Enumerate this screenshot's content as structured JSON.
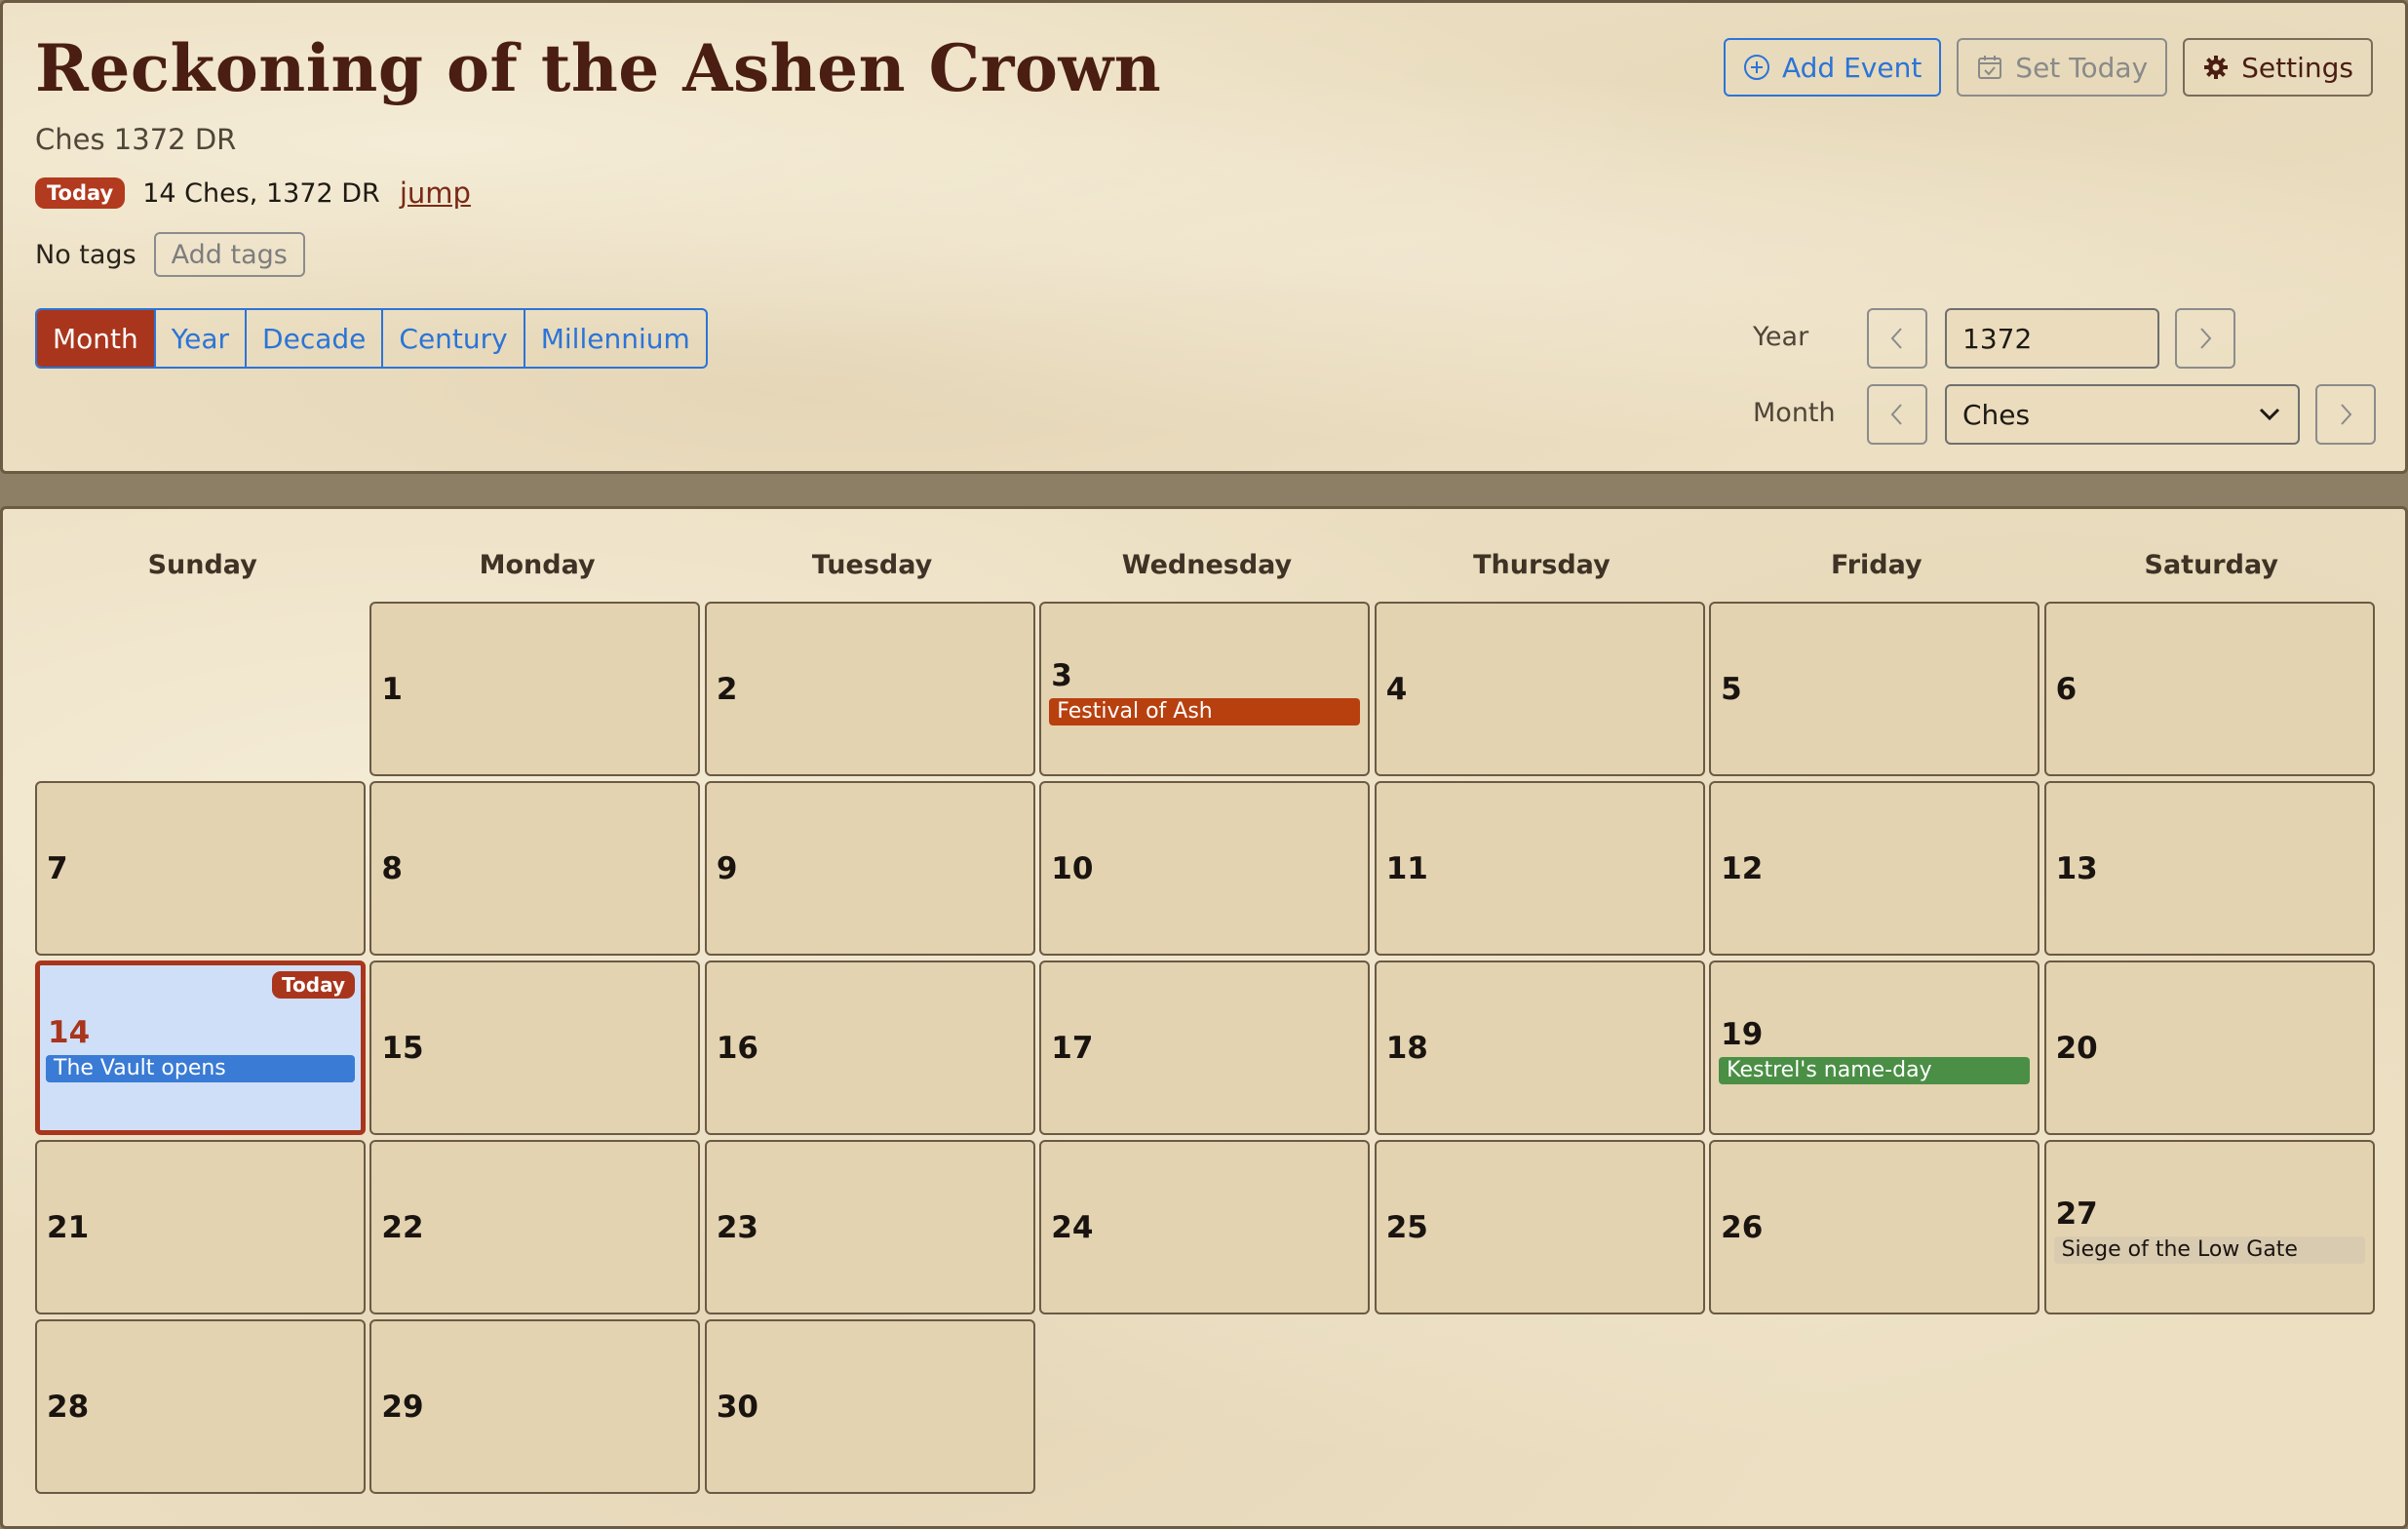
{
  "header": {
    "title": "Reckoning of the Ashen Crown",
    "subtitle": "Ches 1372 DR",
    "today_pill": "Today",
    "today_date": "14 Ches, 1372 DR",
    "jump_label": "jump",
    "tags_label": "No tags",
    "add_tags_label": "Add tags",
    "view_tabs": [
      "Month",
      "Year",
      "Decade",
      "Century",
      "Millennium"
    ],
    "active_view": "Month",
    "buttons": {
      "add_event": "Add Event",
      "set_today": "Set Today",
      "settings": "Settings"
    },
    "nav": {
      "year_label": "Year",
      "year_value": "1372",
      "month_label": "Month",
      "month_value": "Ches"
    }
  },
  "calendar": {
    "day_names": [
      "Sunday",
      "Monday",
      "Tuesday",
      "Wednesday",
      "Thursday",
      "Friday",
      "Saturday"
    ],
    "first_weekday": 1,
    "days_in_month": 30,
    "today": 14,
    "today_badge": "Today",
    "events": [
      {
        "day": 3,
        "label": "Festival of Ash",
        "color": "#b8400f",
        "text_color": "#ffffff"
      },
      {
        "day": 14,
        "label": "The Vault opens",
        "color": "#3a7bd5",
        "text_color": "#ffffff"
      },
      {
        "day": 19,
        "label": "Kestrel's name-day",
        "color": "#4a8f45",
        "text_color": "#ffffff"
      },
      {
        "day": 27,
        "label": "Siege of the Low Gate",
        "color": "#d9cbb0",
        "text_color": "#1a1410"
      }
    ]
  },
  "colors": {
    "accent": "#a9351c",
    "link_blue": "#2b74d8",
    "cell_bg": "#e3d3b1",
    "today_bg": "#cfdff8"
  }
}
